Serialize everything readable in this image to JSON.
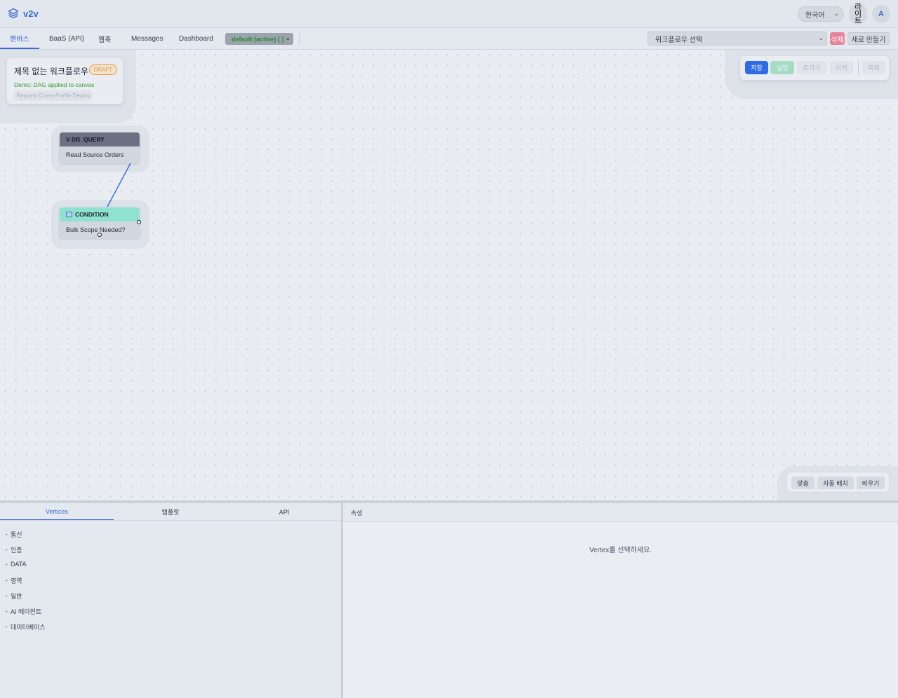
{
  "app": {
    "name": "v2v"
  },
  "header": {
    "language": "한국어",
    "theme_label": "라이트",
    "avatar_initial": "A"
  },
  "tabs": [
    {
      "label": "캔버스",
      "active": true
    },
    {
      "label": "BaaS (API)"
    },
    {
      "label": "웹훅"
    },
    {
      "label": "Messages"
    },
    {
      "label": "Dashboard"
    }
  ],
  "profile_select": "default (active) ( )",
  "workflow_select": {
    "placeholder": "워크플로우 선택"
  },
  "header_actions": {
    "delete": "삭제",
    "new": "새로 만들기"
  },
  "workflow_info": {
    "title": "제목 없는 워크플로우",
    "status": "DRAFT",
    "message": "Demo: DAG applied to canvas",
    "cross_profile_button": "Request Cross-Profile Deploy"
  },
  "canvas_toolbar": {
    "save": "저장",
    "run": "실행",
    "trigger": "트리거",
    "history": "이력",
    "copy": "복제"
  },
  "nodes": [
    {
      "type": "V DB_QUERY",
      "label": "Read Source Orders"
    },
    {
      "type": "CONDITION",
      "label": "Bulk Scope Needed?"
    }
  ],
  "canvas_controls": {
    "fit": "맞춤",
    "auto_layout": "자동 배치",
    "clear": "비우기"
  },
  "bottom_tabs": [
    {
      "label": "Vertices",
      "active": true
    },
    {
      "label": "템플릿"
    },
    {
      "label": "API"
    }
  ],
  "categories": [
    "통신",
    "인증",
    "DATA",
    "영역",
    "일반",
    "AI 에이전트",
    "데이터베이스"
  ],
  "properties": {
    "title": "속성",
    "empty_message": "Vertex를 선택하세요."
  },
  "colors": {
    "accent": "#3b6ad8",
    "save": "#2f6be6",
    "run": "#a5dcc4",
    "delete": "#e6849a",
    "draft": "#e59a4b",
    "condition_header": "#8ee2cf",
    "db_header": "#6b7183"
  },
  "icons": {
    "logo": "layers-icon",
    "condition": "condition-icon"
  }
}
